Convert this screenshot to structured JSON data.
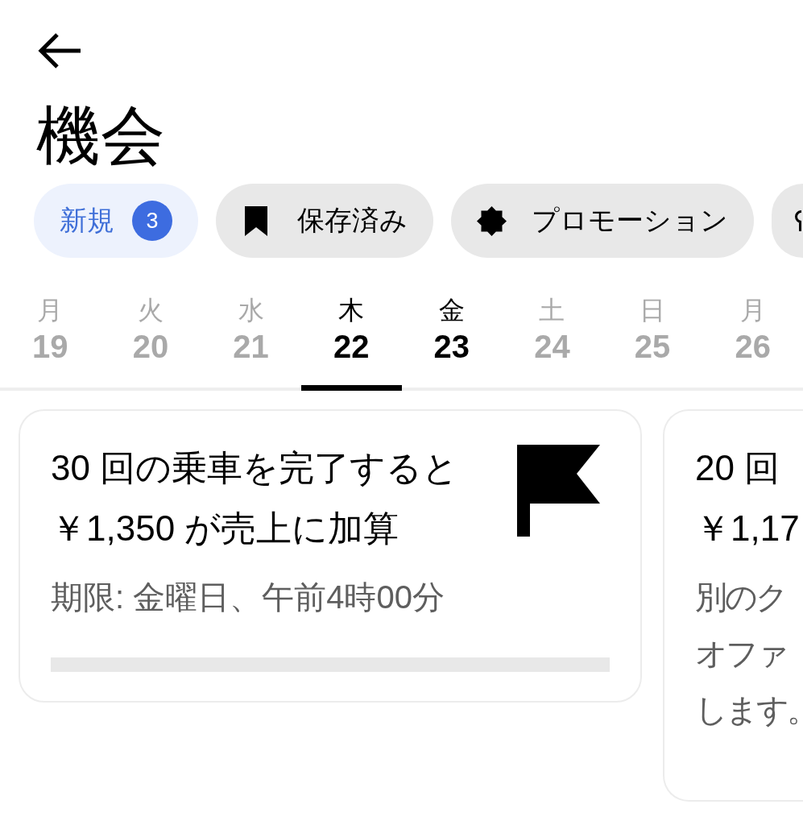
{
  "title": "機会",
  "filter_chips": [
    {
      "kind": "badge",
      "label": "新規",
      "count": "3",
      "selected": true
    },
    {
      "kind": "bookmark",
      "label": "保存済み",
      "selected": false
    },
    {
      "kind": "seal",
      "label": "プロモーション",
      "selected": false
    },
    {
      "kind": "ring",
      "selected": false
    }
  ],
  "days": [
    {
      "weekday": "月",
      "date": "19",
      "selected": false,
      "disabled": true
    },
    {
      "weekday": "火",
      "date": "20",
      "selected": false,
      "disabled": true
    },
    {
      "weekday": "水",
      "date": "21",
      "selected": false,
      "disabled": true
    },
    {
      "weekday": "木",
      "date": "22",
      "selected": true,
      "disabled": false
    },
    {
      "weekday": "金",
      "date": "23",
      "selected": false,
      "disabled": false
    },
    {
      "weekday": "土",
      "date": "24",
      "selected": false,
      "disabled": true
    },
    {
      "weekday": "日",
      "date": "25",
      "selected": false,
      "disabled": true
    },
    {
      "weekday": "月",
      "date": "26",
      "selected": false,
      "disabled": true
    }
  ],
  "cards": [
    {
      "kind": "flag",
      "title_lines": [
        "30 回の乗車を完了すると",
        "￥1,350 が売上に加算"
      ],
      "detail_lines": [
        "期限: 金曜日、午前4時00分"
      ],
      "progress": {
        "level": 0
      }
    },
    {
      "kind": "plain",
      "title_lines": [
        "20 回",
        "￥1,17"
      ],
      "detail_lines": [
        "別のク",
        "オファ",
        "します。"
      ]
    }
  ]
}
